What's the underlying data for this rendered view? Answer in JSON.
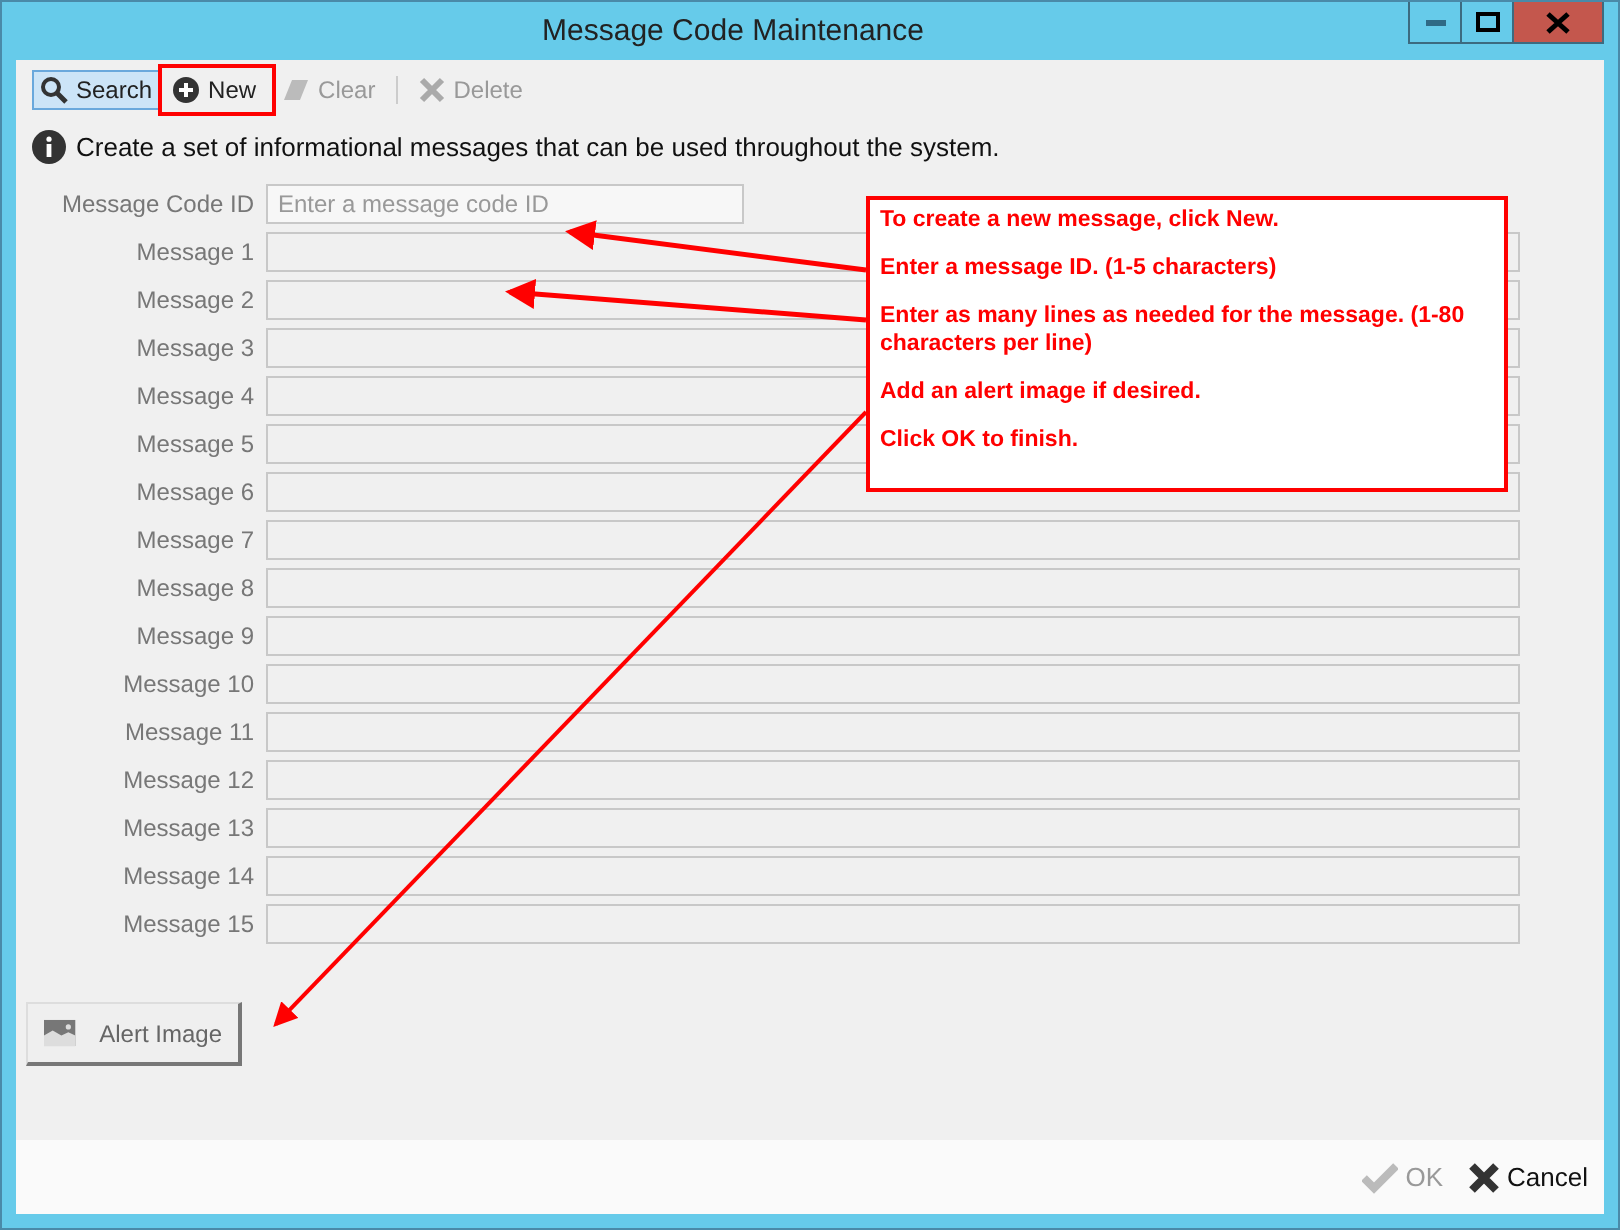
{
  "window": {
    "title": "Message Code Maintenance"
  },
  "toolbar": [
    {
      "kind": "search",
      "label": "Search",
      "selected": true,
      "disabled": false,
      "highlighted": false
    },
    {
      "kind": "new",
      "label": "New",
      "selected": false,
      "disabled": false,
      "highlighted": true
    },
    {
      "kind": "clear",
      "label": "Clear",
      "selected": false,
      "disabled": true,
      "highlighted": false
    },
    {
      "kind": "delete",
      "label": "Delete",
      "selected": false,
      "disabled": true,
      "highlighted": false
    }
  ],
  "info": "Create a set of informational messages that can be used throughout the system.",
  "code_field": {
    "label": "Message Code ID",
    "placeholder": "Enter a message code ID"
  },
  "message_fields": [
    "Message 1",
    "Message 2",
    "Message 3",
    "Message 4",
    "Message 5",
    "Message 6",
    "Message 7",
    "Message 8",
    "Message 9",
    "Message 10",
    "Message 11",
    "Message 12",
    "Message 13",
    "Message 14",
    "Message 15"
  ],
  "alert_button": "Alert Image",
  "callout": [
    "To create a new message, click New.",
    "Enter a message ID. (1-5 characters)",
    "Enter as many lines as needed for the message. (1-80 characters per line)",
    "Add an alert image if desired.",
    "Click OK to finish."
  ],
  "footer": [
    {
      "kind": "ok",
      "label": "OK",
      "disabled": true
    },
    {
      "kind": "cancel",
      "label": "Cancel",
      "disabled": false
    }
  ]
}
